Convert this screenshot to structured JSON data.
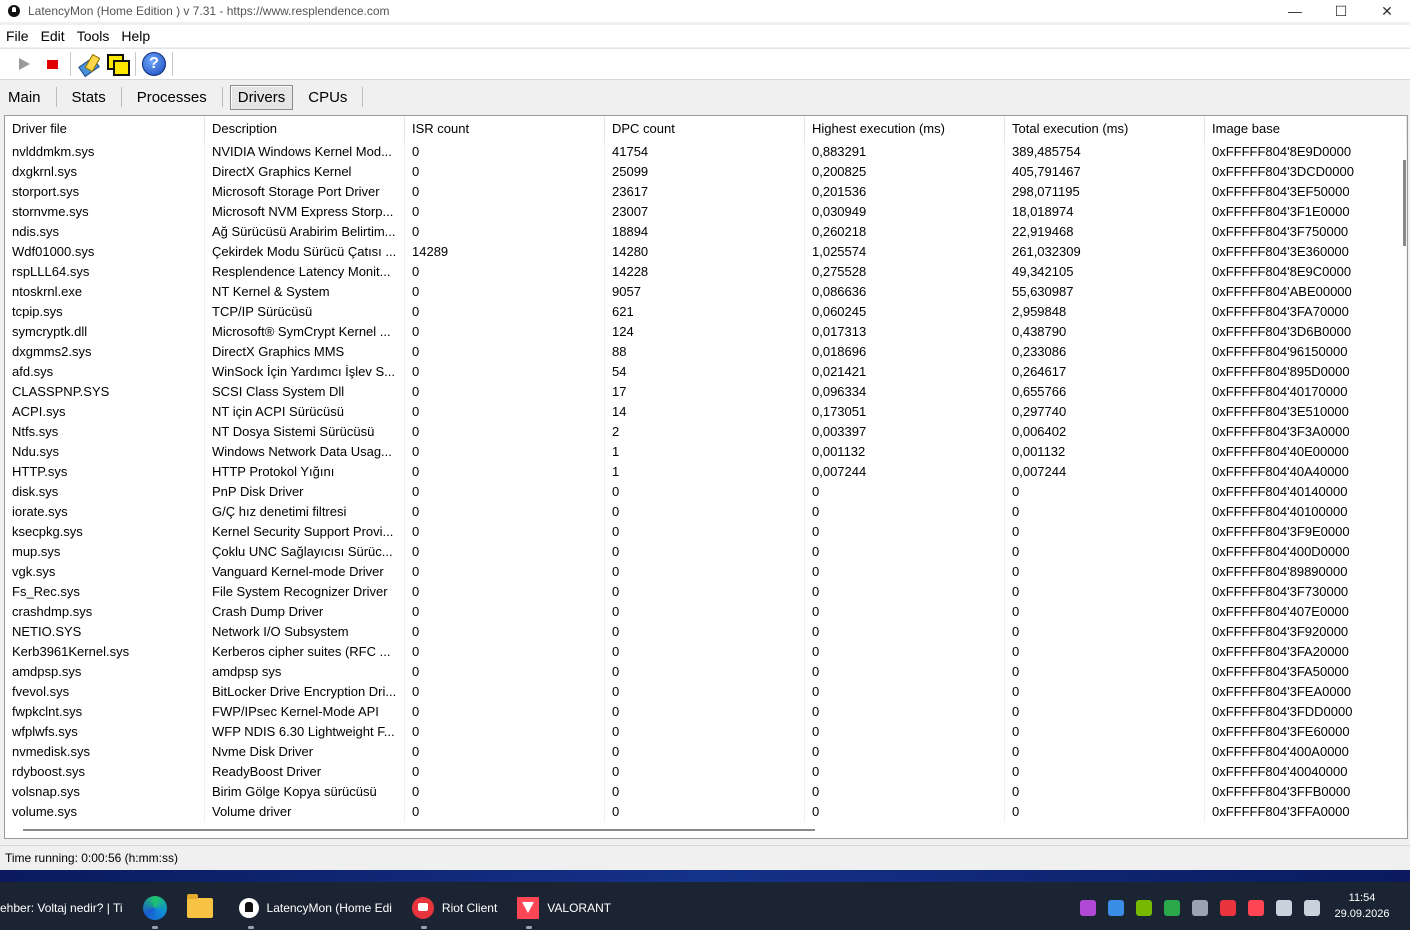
{
  "window": {
    "title": "LatencyMon  (Home Edition )  v 7.31 - https://www.resplendence.com",
    "minimize": "—",
    "maximize": "☐",
    "close": "✕"
  },
  "menu": [
    "File",
    "Edit",
    "Tools",
    "Help"
  ],
  "toolbar": {
    "buttons": [
      "play-icon",
      "stop-icon",
      "tools-icon",
      "windows-icon",
      "help-icon"
    ],
    "help_glyph": "?"
  },
  "tabs": [
    "Main",
    "Stats",
    "Processes",
    "Drivers",
    "CPUs"
  ],
  "active_tab": "Drivers",
  "table": {
    "columns": [
      "Driver file",
      "Description",
      "ISR count",
      "DPC count",
      "Highest execution (ms)",
      "Total execution (ms)",
      "Image base"
    ],
    "rows": [
      [
        "nvlddmkm.sys",
        "NVIDIA Windows Kernel Mod...",
        "0",
        "41754",
        "0,883291",
        "389,485754",
        "0xFFFFF804'8E9D0000"
      ],
      [
        "dxgkrnl.sys",
        "DirectX Graphics Kernel",
        "0",
        "25099",
        "0,200825",
        "405,791467",
        "0xFFFFF804'3DCD0000"
      ],
      [
        "storport.sys",
        "Microsoft Storage Port Driver",
        "0",
        "23617",
        "0,201536",
        "298,071195",
        "0xFFFFF804'3EF50000"
      ],
      [
        "stornvme.sys",
        "Microsoft NVM Express Storp...",
        "0",
        "23007",
        "0,030949",
        "18,018974",
        "0xFFFFF804'3F1E0000"
      ],
      [
        "ndis.sys",
        "Ağ Sürücüsü Arabirim Belirtim...",
        "0",
        "18894",
        "0,260218",
        "22,919468",
        "0xFFFFF804'3F750000"
      ],
      [
        "Wdf01000.sys",
        "Çekirdek Modu Sürücü Çatısı ...",
        "14289",
        "14280",
        "1,025574",
        "261,032309",
        "0xFFFFF804'3E360000"
      ],
      [
        "rspLLL64.sys",
        "Resplendence Latency Monit...",
        "0",
        "14228",
        "0,275528",
        "49,342105",
        "0xFFFFF804'8E9C0000"
      ],
      [
        "ntoskrnl.exe",
        "NT Kernel & System",
        "0",
        "9057",
        "0,086636",
        "55,630987",
        "0xFFFFF804'ABE00000"
      ],
      [
        "tcpip.sys",
        "TCP/IP Sürücüsü",
        "0",
        "621",
        "0,060245",
        "2,959848",
        "0xFFFFF804'3FA70000"
      ],
      [
        "symcryptk.dll",
        "Microsoft® SymCrypt Kernel ...",
        "0",
        "124",
        "0,017313",
        "0,438790",
        "0xFFFFF804'3D6B0000"
      ],
      [
        "dxgmms2.sys",
        "DirectX Graphics MMS",
        "0",
        "88",
        "0,018696",
        "0,233086",
        "0xFFFFF804'96150000"
      ],
      [
        "afd.sys",
        "WinSock İçin Yardımcı İşlev S...",
        "0",
        "54",
        "0,021421",
        "0,264617",
        "0xFFFFF804'895D0000"
      ],
      [
        "CLASSPNP.SYS",
        "SCSI Class System Dll",
        "0",
        "17",
        "0,096334",
        "0,655766",
        "0xFFFFF804'40170000"
      ],
      [
        "ACPI.sys",
        "NT için ACPI Sürücüsü",
        "0",
        "14",
        "0,173051",
        "0,297740",
        "0xFFFFF804'3E510000"
      ],
      [
        "Ntfs.sys",
        "NT Dosya Sistemi Sürücüsü",
        "0",
        "2",
        "0,003397",
        "0,006402",
        "0xFFFFF804'3F3A0000"
      ],
      [
        "Ndu.sys",
        "Windows Network Data Usag...",
        "0",
        "1",
        "0,001132",
        "0,001132",
        "0xFFFFF804'40E00000"
      ],
      [
        "HTTP.sys",
        "HTTP Protokol Yığını",
        "0",
        "1",
        "0,007244",
        "0,007244",
        "0xFFFFF804'40A40000"
      ],
      [
        "disk.sys",
        "PnP Disk Driver",
        "0",
        "0",
        "0",
        "0",
        "0xFFFFF804'40140000"
      ],
      [
        "iorate.sys",
        "G/Ç hız denetimi filtresi",
        "0",
        "0",
        "0",
        "0",
        "0xFFFFF804'40100000"
      ],
      [
        "ksecpkg.sys",
        "Kernel Security Support Provi...",
        "0",
        "0",
        "0",
        "0",
        "0xFFFFF804'3F9E0000"
      ],
      [
        "mup.sys",
        "Çoklu UNC Sağlayıcısı Sürüc...",
        "0",
        "0",
        "0",
        "0",
        "0xFFFFF804'400D0000"
      ],
      [
        "vgk.sys",
        "Vanguard Kernel-mode Driver",
        "0",
        "0",
        "0",
        "0",
        "0xFFFFF804'89890000"
      ],
      [
        "Fs_Rec.sys",
        "File System Recognizer Driver",
        "0",
        "0",
        "0",
        "0",
        "0xFFFFF804'3F730000"
      ],
      [
        "crashdmp.sys",
        "Crash Dump Driver",
        "0",
        "0",
        "0",
        "0",
        "0xFFFFF804'407E0000"
      ],
      [
        "NETIO.SYS",
        "Network I/O Subsystem",
        "0",
        "0",
        "0",
        "0",
        "0xFFFFF804'3F920000"
      ],
      [
        "Kerb3961Kernel.sys",
        "Kerberos cipher suites (RFC ...",
        "0",
        "0",
        "0",
        "0",
        "0xFFFFF804'3FA20000"
      ],
      [
        "amdpsp.sys",
        "amdpsp sys",
        "0",
        "0",
        "0",
        "0",
        "0xFFFFF804'3FA50000"
      ],
      [
        "fvevol.sys",
        "BitLocker Drive Encryption Dri...",
        "0",
        "0",
        "0",
        "0",
        "0xFFFFF804'3FEA0000"
      ],
      [
        "fwpkclnt.sys",
        "FWP/IPsec Kernel-Mode API",
        "0",
        "0",
        "0",
        "0",
        "0xFFFFF804'3FDD0000"
      ],
      [
        "wfplwfs.sys",
        "WFP NDIS 6.30 Lightweight F...",
        "0",
        "0",
        "0",
        "0",
        "0xFFFFF804'3FE60000"
      ],
      [
        "nvmedisk.sys",
        "Nvme Disk Driver",
        "0",
        "0",
        "0",
        "0",
        "0xFFFFF804'400A0000"
      ],
      [
        "rdyboost.sys",
        "ReadyBoost Driver",
        "0",
        "0",
        "0",
        "0",
        "0xFFFFF804'40040000"
      ],
      [
        "volsnap.sys",
        "Birim Gölge Kopya sürücüsü",
        "0",
        "0",
        "0",
        "0",
        "0xFFFFF804'3FFB0000"
      ],
      [
        "volume.sys",
        "Volume driver",
        "0",
        "0",
        "0",
        "0",
        "0xFFFFF804'3FFA0000"
      ]
    ]
  },
  "status": {
    "text": "Time running: 0:00:56  (h:mm:ss)"
  },
  "taskbar": {
    "items": [
      {
        "icon": "",
        "label": "ehber: Voltaj nedir? | Ti"
      },
      {
        "icon": "edge-icon",
        "label": ""
      },
      {
        "icon": "folder-icon",
        "label": ""
      },
      {
        "icon": "latencymon-icon",
        "label": "LatencyMon  (Home Edi"
      },
      {
        "icon": "riot-icon",
        "label": "Riot Client"
      },
      {
        "icon": "valorant-icon",
        "label": "VALORANT"
      }
    ],
    "tray_icons": [
      "camera-icon",
      "network-monitor-icon",
      "nvidia-icon",
      "security-icon",
      "offline-cloud-icon",
      "riot-tray-icon",
      "vanguard-icon",
      "display-icon",
      "volume-icon"
    ],
    "tray_colors": [
      "#b04ad6",
      "#3a8ee6",
      "#76b900",
      "#2aa84a",
      "#9aa3b0",
      "#e8353d",
      "#ff4655",
      "#c9d1dc",
      "#c9d1dc"
    ],
    "time": "11:54",
    "date": "29.09.2026"
  }
}
